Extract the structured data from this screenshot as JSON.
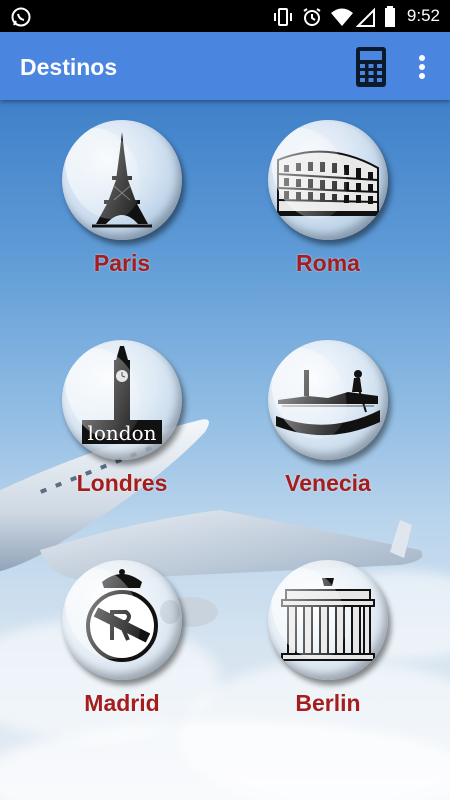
{
  "status_bar": {
    "time": "9:52",
    "icons": [
      "whatsapp-icon",
      "vibrate-icon",
      "alarm-icon",
      "wifi-icon",
      "signal-icon",
      "battery-icon"
    ]
  },
  "app_bar": {
    "title": "Destinos",
    "background_color": "#4a86e0",
    "actions": [
      "calculator-icon",
      "more-options-icon"
    ]
  },
  "destinations": [
    {
      "name": "Paris",
      "icon": "eiffel-tower-icon"
    },
    {
      "name": "Roma",
      "icon": "colosseum-icon"
    },
    {
      "name": "Londres",
      "icon": "big-ben-icon"
    },
    {
      "name": "Venecia",
      "icon": "gondola-icon"
    },
    {
      "name": "Madrid",
      "icon": "real-madrid-crest-icon"
    },
    {
      "name": "Berlin",
      "icon": "brandenburg-gate-icon"
    }
  ],
  "label_color": "#a51d1d",
  "background": "sky-with-airplane",
  "image_text": {
    "london_word": "london"
  }
}
